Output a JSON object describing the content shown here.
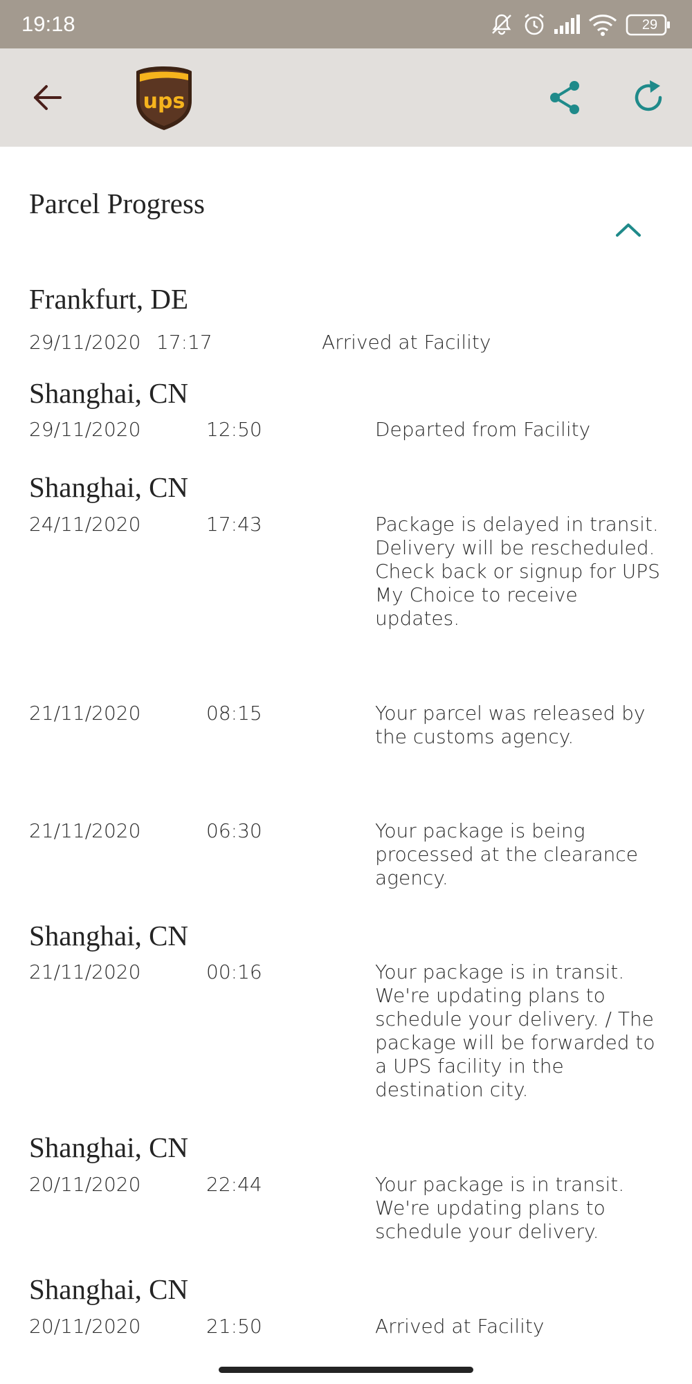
{
  "status_bar": {
    "time": "19:18",
    "battery": "29",
    "icons": [
      "bell-muted-icon",
      "alarm-icon",
      "signal-icon",
      "wifi-icon",
      "battery-icon"
    ]
  },
  "app_bar": {
    "back_icon": "arrow-left-icon",
    "logo": "ups",
    "share_icon": "share-icon",
    "refresh_icon": "refresh-icon",
    "colors": {
      "background": "#e2dfdc",
      "accent": "#1f8a8a",
      "back": "#4a1f1a"
    }
  },
  "progress": {
    "title": "Parcel Progress",
    "collapse_icon": "chevron-up-icon",
    "events": [
      {
        "location": "Frankfurt, DE",
        "date": "29/11/2020",
        "time": "17:17",
        "status": "Arrived at Facility"
      },
      {
        "location": "Shanghai, CN",
        "date": "29/11/2020",
        "time": "12:50",
        "status": "Departed from Facility"
      },
      {
        "location": "Shanghai, CN",
        "date": "24/11/2020",
        "time": "17:43",
        "status": "Package is delayed in transit. Delivery will be rescheduled. Check back or signup for UPS My Choice to receive updates."
      },
      {
        "location": "",
        "date": "21/11/2020",
        "time": "08:15",
        "status": "Your parcel was released by the customs agency."
      },
      {
        "location": "",
        "date": "21/11/2020",
        "time": "06:30",
        "status": "Your package is being processed at the clearance agency."
      },
      {
        "location": "Shanghai, CN",
        "date": "21/11/2020",
        "time": "00:16",
        "status": "Your package is in transit. We're updating plans to schedule your delivery. / The package will be forwarded to a UPS facility in the destination city."
      },
      {
        "location": "Shanghai, CN",
        "date": "20/11/2020",
        "time": "22:44",
        "status": "Your package is in transit. We're updating plans to schedule your delivery."
      },
      {
        "location": "Shanghai, CN",
        "date": "20/11/2020",
        "time": "21:50",
        "status": "Arrived at Facility"
      }
    ]
  }
}
